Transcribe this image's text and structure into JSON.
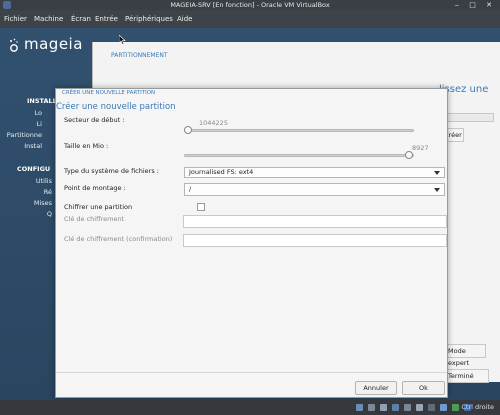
{
  "window": {
    "title": "MAGEIA-SRV [En fonction] - Oracle VM VirtualBox",
    "controls": "‒ □ ✕"
  },
  "menu": [
    "Fichier",
    "Machine",
    "Écran",
    "Entrée",
    "Périphériques",
    "Aide"
  ],
  "sidebar": {
    "logo": "mageia",
    "sections": [
      {
        "title": "INSTALL",
        "items": [
          "Lo",
          "Li",
          "Partitionne",
          "Instal"
        ]
      },
      {
        "title": "CONFIGU",
        "items": [
          "Utilis",
          "Ré",
          "Mises",
          "Q"
        ]
      }
    ]
  },
  "background": {
    "section_title": "PARTITIONNEMENT",
    "heading_fragment": "lissez une",
    "create_button": "Créer",
    "expert_button": "Mode expert",
    "done_button": "Terminé"
  },
  "dialog": {
    "header": "CRÉER UNE NOUVELLE PARTITION",
    "title": "Créer une nouvelle partition",
    "start_sector_label": "Secteur de début :",
    "start_sector_value": "1044225",
    "start_sector_fraction": 0.0,
    "size_label": "Taille en Mio :",
    "size_value": "8927",
    "size_fraction": 0.98,
    "fs_type_label": "Type du système de fichiers :",
    "fs_type_value": "Journalised FS: ext4",
    "mount_label": "Point de montage :",
    "mount_value": "/",
    "encrypt_label": "Chiffrer une partition",
    "encrypt_checked": false,
    "key_label": "Clé de chiffrement",
    "key_confirm_label": "Clé de chiffrement (confirmation)",
    "cancel_button": "Annuler",
    "ok_button": "Ok"
  },
  "taskbar": {
    "host_key": "Ctrl droite"
  }
}
